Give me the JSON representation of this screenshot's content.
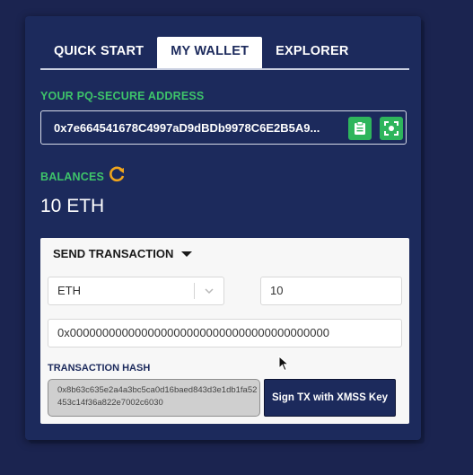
{
  "tabs": [
    {
      "label": "QUICK START",
      "active": false
    },
    {
      "label": "MY WALLET",
      "active": true
    },
    {
      "label": "EXPLORER",
      "active": false
    }
  ],
  "address": {
    "label": "YOUR PQ-SECURE ADDRESS",
    "value": "0x7e664541678C4997aD9dBDb9978C6E2B5A9..."
  },
  "balances": {
    "label": "BALANCES",
    "value": "10 ETH"
  },
  "send": {
    "header": "SEND TRANSACTION",
    "currency": "ETH",
    "amount": "10",
    "to_address": "0x0000000000000000000000000000000000000000",
    "hash_label": "TRANSACTION HASH",
    "hash_value": "0x8b63c635e2a4a3bc5ca0d16baed843d3e1db1fa52453c14f36a822e7002c6030",
    "sign_label": "Sign TX with XMSS Key"
  },
  "colors": {
    "background": "#1b2450",
    "panel": "#1c2a5c",
    "accent_green": "#3ec46a",
    "refresh_orange": "#f0a51c",
    "card": "#f7f7f7"
  },
  "icons": [
    "clipboard-icon",
    "scan-icon",
    "refresh-icon",
    "chevron-down-icon",
    "caret-down-icon",
    "mouse-cursor-icon"
  ]
}
